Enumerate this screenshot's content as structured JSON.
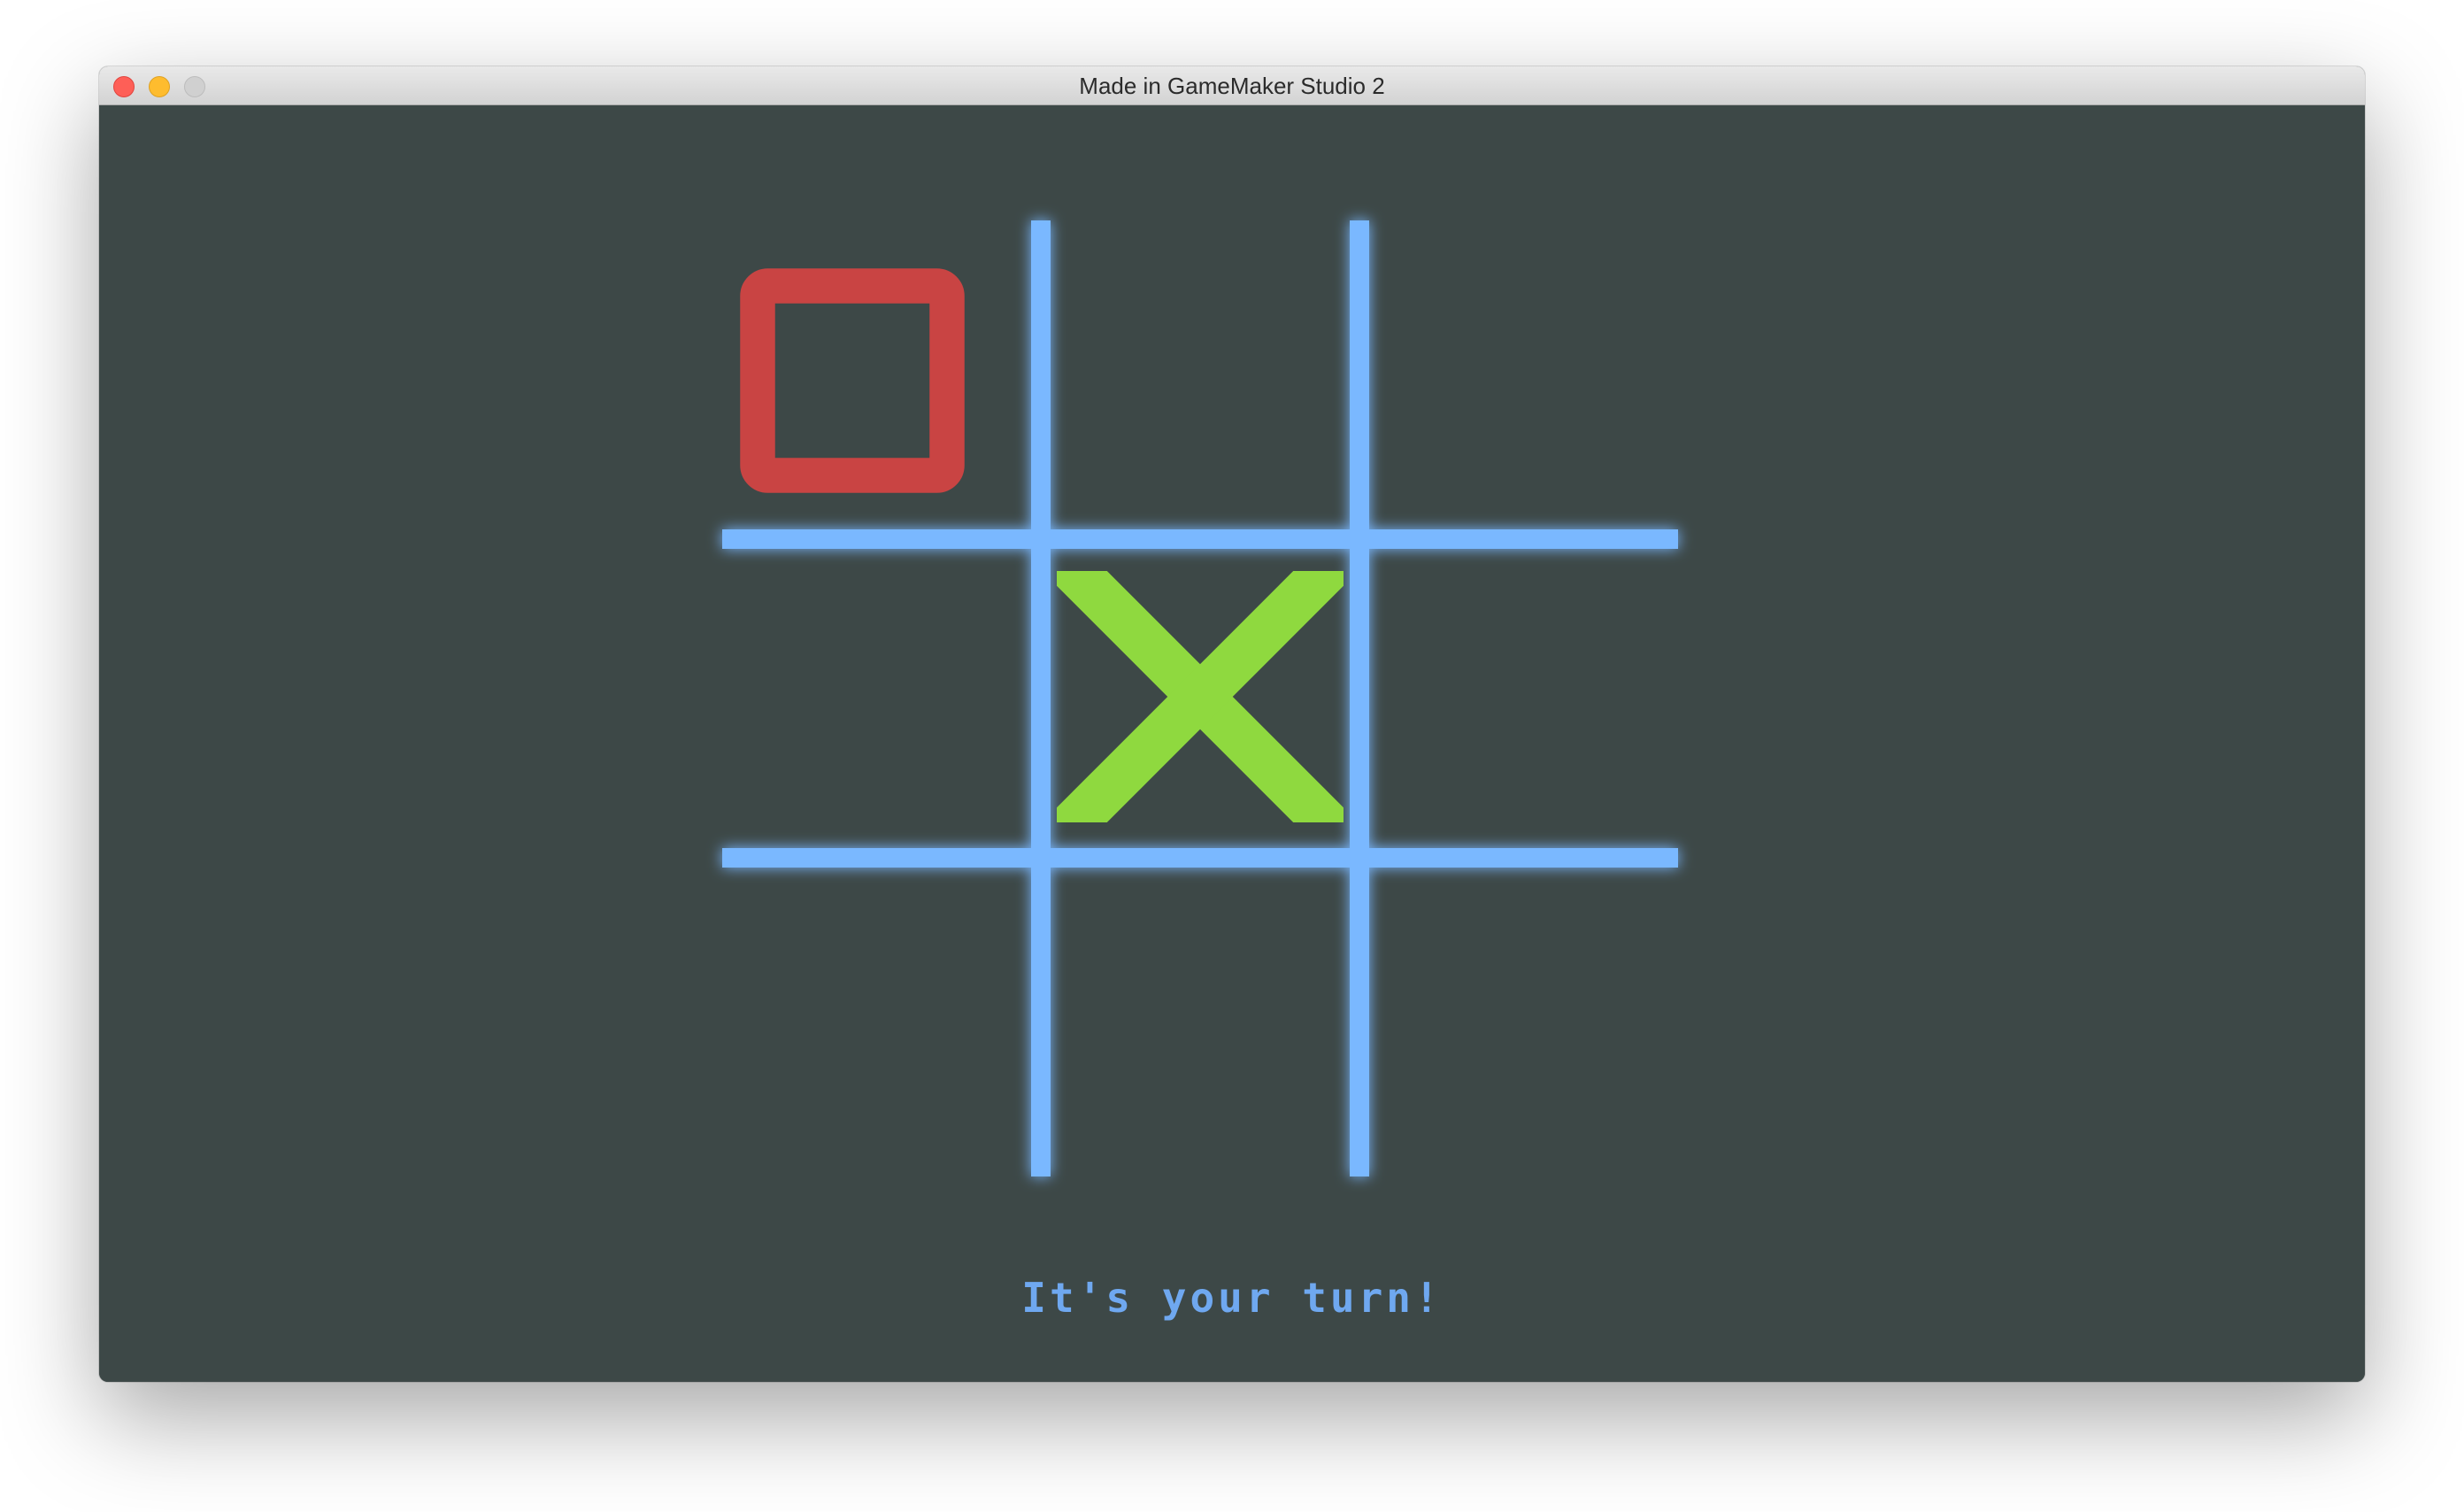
{
  "window": {
    "title": "Made in GameMaker Studio 2"
  },
  "game": {
    "status_text": "It's your turn!",
    "board": [
      [
        "O",
        "",
        ""
      ],
      [
        "",
        "X",
        ""
      ],
      [
        "",
        "",
        ""
      ]
    ],
    "colors": {
      "background": "#3d4847",
      "grid": "#7ab8ff",
      "o_mark": "#c94443",
      "x_mark": "#8fd93f",
      "status_text": "#6fa8f0"
    }
  }
}
